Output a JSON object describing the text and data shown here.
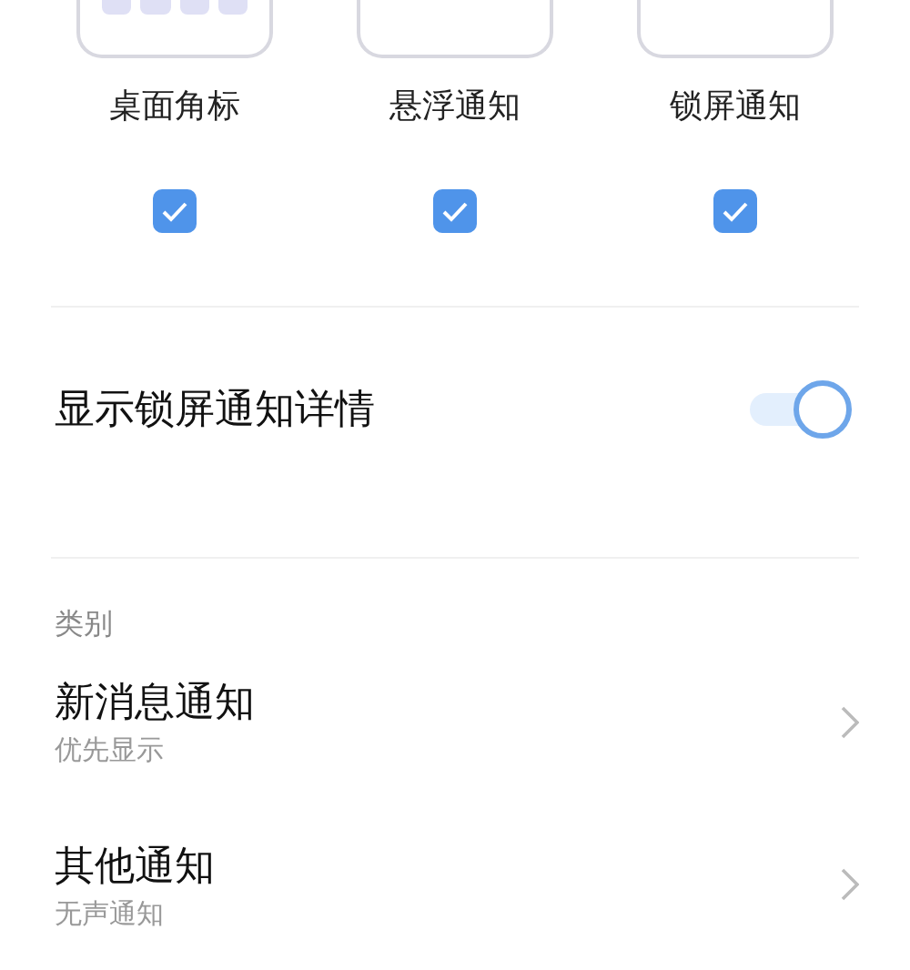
{
  "styles": [
    {
      "kind": "badge",
      "label": "桌面角标",
      "checked": true
    },
    {
      "kind": "banner",
      "label": "悬浮通知",
      "checked": true
    },
    {
      "kind": "lockscreen",
      "label": "锁屏通知",
      "checked": true
    }
  ],
  "lock_details": {
    "label": "显示锁屏通知详情",
    "on": true
  },
  "category": {
    "heading": "类别",
    "items": [
      {
        "title": "新消息通知",
        "subtitle": "优先显示"
      },
      {
        "title": "其他通知",
        "subtitle": "无声通知"
      }
    ]
  }
}
